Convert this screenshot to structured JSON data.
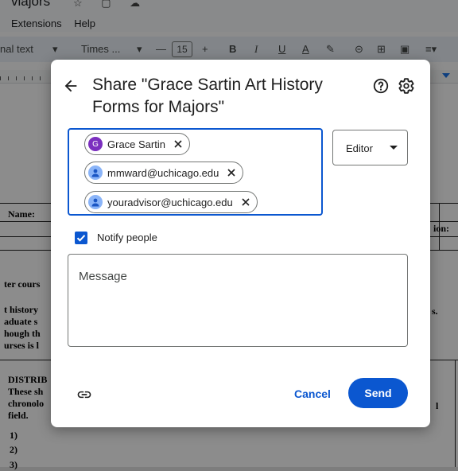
{
  "doc": {
    "title_fragment": "viajors",
    "menus": [
      "Extensions",
      "Help"
    ],
    "toolbar": {
      "style": "nal text",
      "font": "Times ...",
      "minus": "—",
      "size": "15",
      "plus": "+",
      "bold": "B",
      "italic": "I",
      "underline": "U",
      "text_color": "A"
    },
    "body_text": {
      "name_label": "Name:",
      "ion_label": "ion:",
      "ter_cours": "ter cours",
      "history_block": "t history\naduate s\nhough th\nurses is l",
      "s_dot": "s.",
      "distri_block": "DISTRIB\nThese sh\nchronolo\nfield.",
      "item1": "1)",
      "item2": "2)",
      "item3": "3)",
      "l_letter": "l"
    }
  },
  "dialog": {
    "title": "Share \"Grace Sartin Art History Forms for Majors\"",
    "recipients": [
      {
        "name": "Grace Sartin",
        "avatar_letter": "G",
        "avatar_color": "#7b2fbf"
      },
      {
        "name": "mmward@uchicago.edu",
        "avatar_letter": "",
        "avatar_color": "#8ab4f8"
      },
      {
        "name": "youradvisor@uchicago.edu",
        "avatar_letter": "",
        "avatar_color": "#8ab4f8"
      }
    ],
    "role": "Editor",
    "notify_label": "Notify people",
    "notify_checked": true,
    "message_placeholder": "Message",
    "cancel_label": "Cancel",
    "send_label": "Send"
  },
  "icons": {
    "back": "arrow-back-icon",
    "help": "help-icon",
    "settings": "gear-icon",
    "remove": "close-icon",
    "role_dropdown": "chevron-down-icon",
    "copy_link": "link-icon",
    "checkbox": "check-icon"
  },
  "colors": {
    "accent": "#0b57d0",
    "overlay": "rgba(0,0,0,0.45)"
  }
}
